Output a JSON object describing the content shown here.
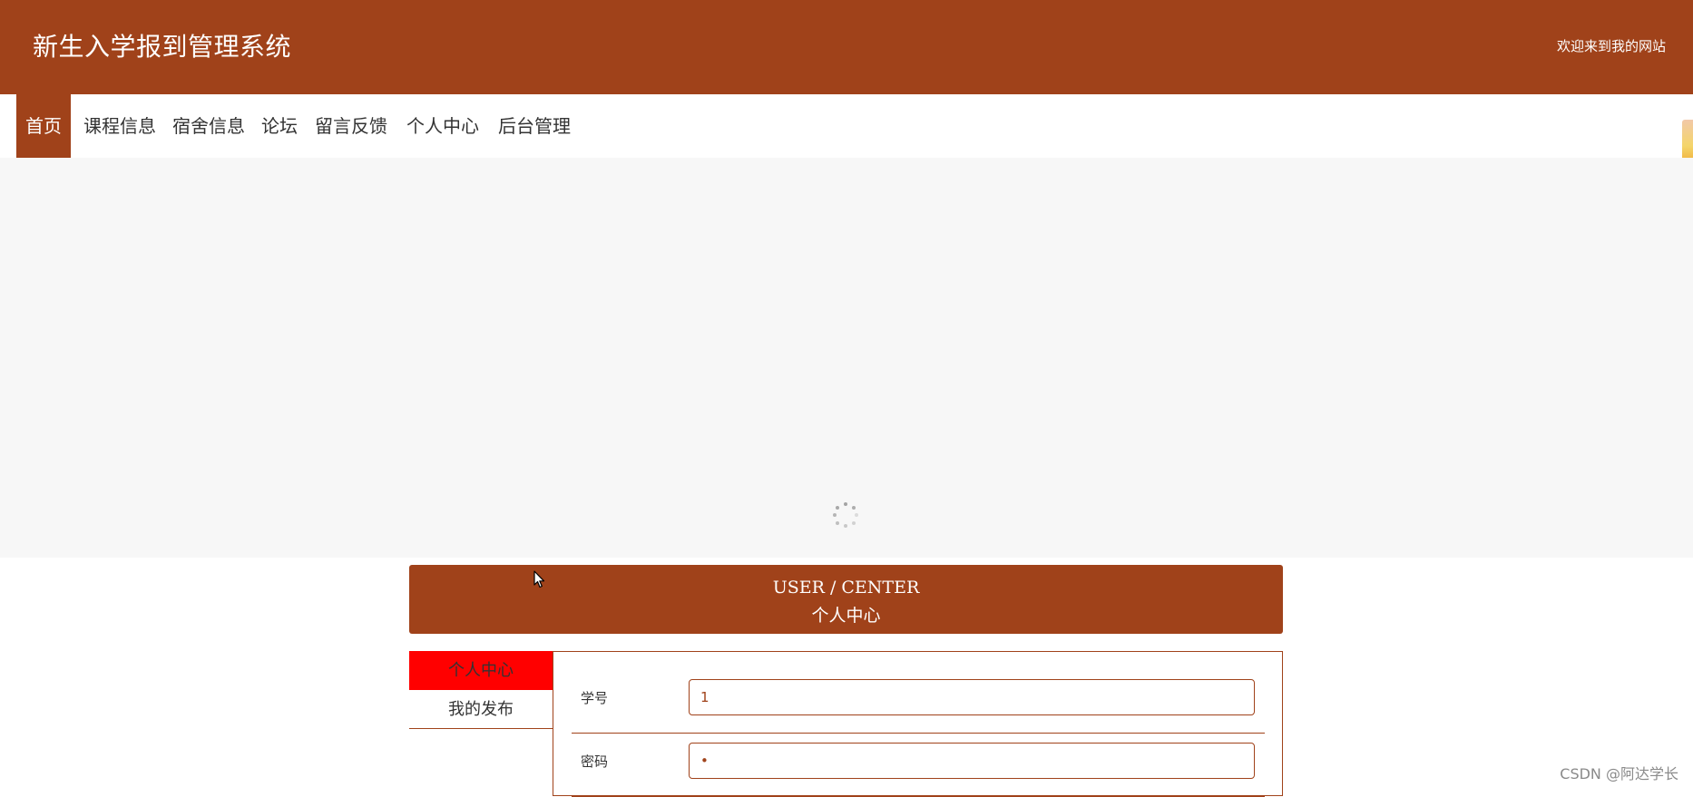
{
  "header": {
    "title": "新生入学报到管理系统",
    "welcome": "欢迎来到我的网站"
  },
  "nav": {
    "items": [
      {
        "label": "首页",
        "active": true
      },
      {
        "label": "课程信息"
      },
      {
        "label": "宿舍信息"
      },
      {
        "label": "论坛"
      },
      {
        "label": "留言反馈"
      },
      {
        "label": "个人中心"
      },
      {
        "label": "后台管理"
      }
    ]
  },
  "user_center": {
    "title_en": "USER / CENTER",
    "title_cn": "个人中心"
  },
  "side_menu": {
    "items": [
      {
        "label": "个人中心",
        "active": true
      },
      {
        "label": "我的发布"
      }
    ]
  },
  "form": {
    "fields": [
      {
        "label": "学号",
        "value": "1"
      },
      {
        "label": "密码",
        "value": "•"
      }
    ]
  },
  "watermark": "CSDN @阿达学长",
  "colors": {
    "brand": "#a0421a",
    "active_side": "#ff0000",
    "banner_bg": "#f7f7f7"
  },
  "icons": [
    "loading-spinner-icon",
    "mouse-cursor-icon"
  ]
}
